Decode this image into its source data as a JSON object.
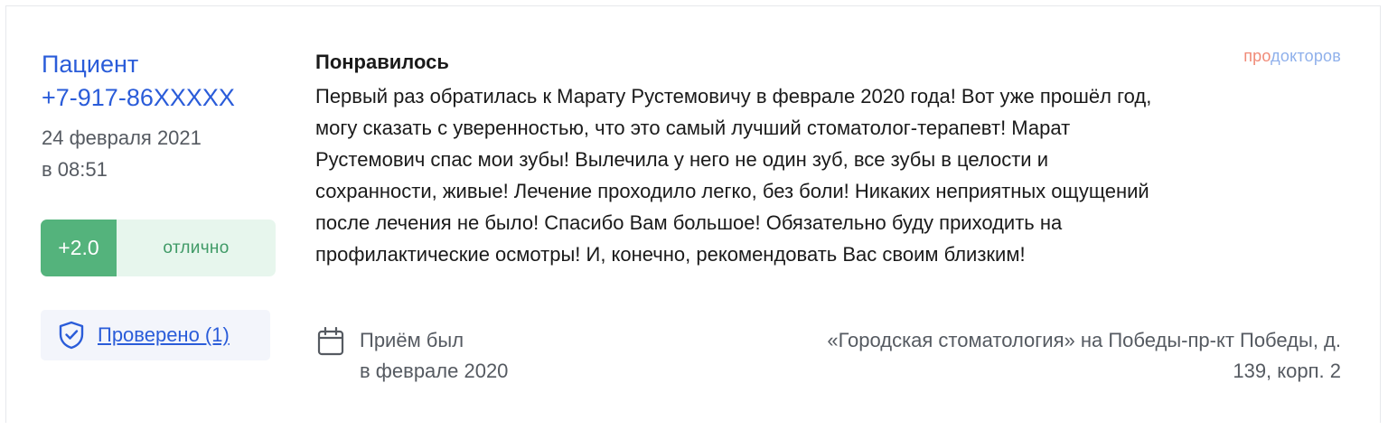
{
  "author": {
    "name": "Пациент",
    "phone": "+7-917-86XXXXX"
  },
  "date": {
    "line1": "24 февраля 2021",
    "line2": "в 08:51"
  },
  "rating": {
    "score": "+2.0",
    "label": "отлично"
  },
  "verified": {
    "label": "Проверено (1)",
    "icon": "shield-check-icon"
  },
  "brand": {
    "part1": "про",
    "part2": "докторов",
    "colors": {
      "part1": "#f08a77",
      "part2": "#8fb0eb"
    }
  },
  "review": {
    "title": "Понравилось",
    "lines": [
      "Первый раз обратилась к Марату Рустемовичу в феврале 2020 года! Вот уже прошёл год,",
      "могу сказать с уверенностью, что это самый лучший стоматолог-терапевт! Марат",
      "Рустемович спас мои зубы! Вылечила у него не один зуб, все зубы в целости и",
      "сохранности, живые! Лечение проходило легко, без боли! Никаких неприятных ощущений",
      "после лечения не было! Спасибо Вам большое! Обязательно буду приходить на",
      "профилактические осмотры! И, конечно, рекомендовать Вас своим близким!"
    ]
  },
  "visit": {
    "icon": "calendar-icon",
    "line1": "Приём был",
    "line2": "в феврале 2020"
  },
  "clinic": {
    "line1": "«Городская стоматология» на Победы-пр-кт Победы, д.",
    "line2": "139, корп. 2"
  },
  "colors": {
    "link": "#2a5cd9",
    "rating_score_bg": "#54b37c",
    "rating_label_bg": "#e7f6ed",
    "rating_label_text": "#3f9a66",
    "muted_text": "#555a61"
  }
}
